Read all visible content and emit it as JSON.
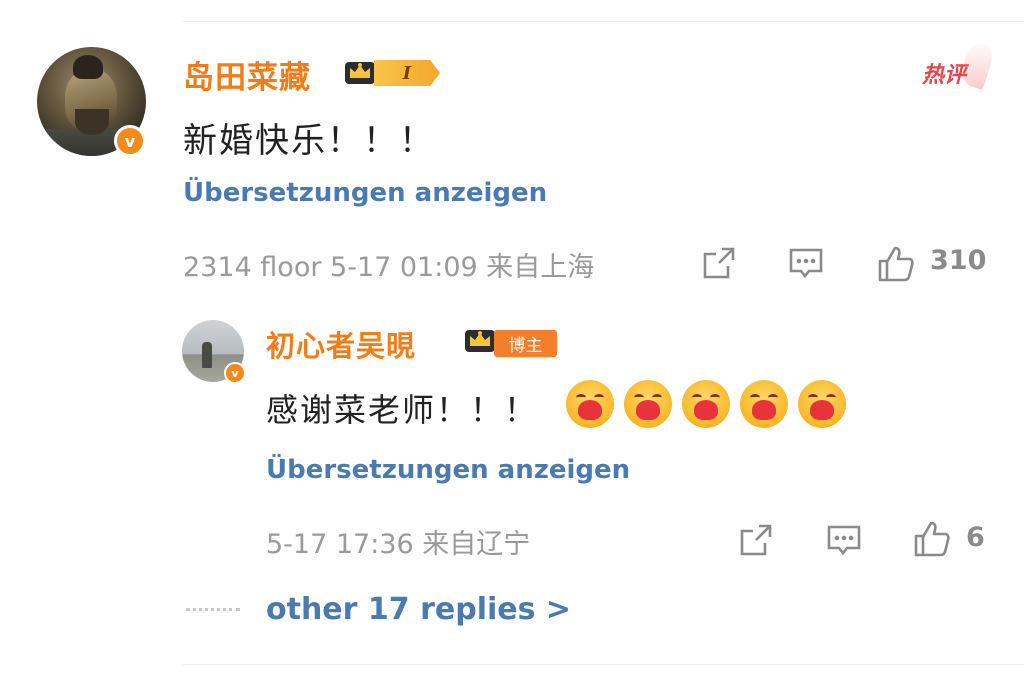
{
  "main_comment": {
    "username": "岛田菜藏",
    "level": "I",
    "hot_badge": "热评",
    "text": "新婚快乐！！！",
    "translate_label": "Übersetzungen anzeigen",
    "meta": "2314 floor  5-17 01:09  来自上海",
    "like_count": "310",
    "verified_glyph": "v"
  },
  "reply": {
    "username": "初心者吴晛",
    "host_label": "博主",
    "text": "感谢菜老师！！！",
    "emoji_count": 5,
    "emoji_name": "hug-heart-emoji",
    "translate_label": "Übersetzungen anzeigen",
    "meta": "5-17 17:36  来自辽宁",
    "like_count": "6",
    "verified_glyph": "v"
  },
  "more_replies_label": "other 17 replies >",
  "icons": {
    "share": "share-icon",
    "comment": "comment-icon",
    "like": "thumbs-up-icon",
    "crown": "crown-icon"
  },
  "colors": {
    "username": "#f07d1a",
    "link": "#4a7ab0",
    "meta": "#9a9a9a",
    "hot": "#e1474c",
    "verified": "#f28a1c"
  }
}
